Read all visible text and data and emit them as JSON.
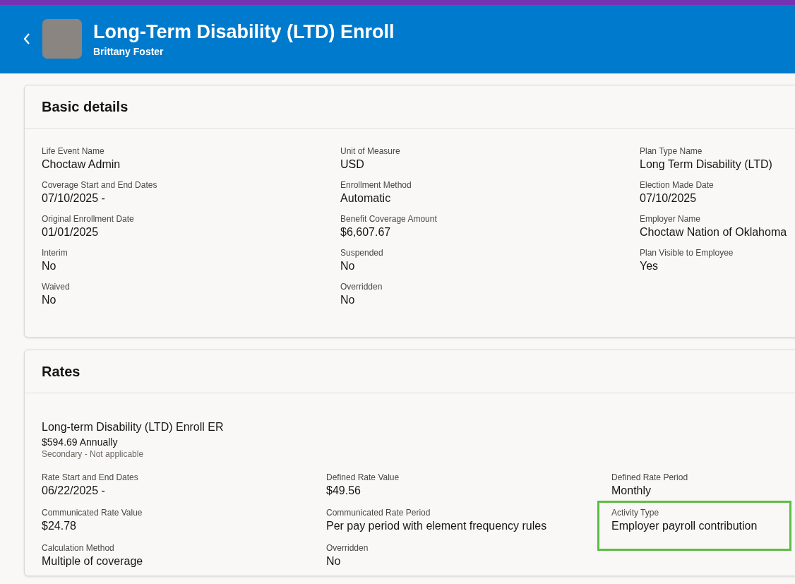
{
  "header": {
    "title": "Long-Term Disability (LTD) Enroll",
    "subtitle": "Brittany Foster"
  },
  "basic_details": {
    "title": "Basic details",
    "fields": [
      {
        "label": "Life Event Name",
        "value": "Choctaw Admin"
      },
      {
        "label": "Unit of Measure",
        "value": "USD"
      },
      {
        "label": "Plan Type Name",
        "value": "Long Term Disability (LTD)"
      },
      {
        "label": "Coverage Start and End Dates",
        "value": "07/10/2025 -"
      },
      {
        "label": "Enrollment Method",
        "value": "Automatic"
      },
      {
        "label": "Election Made Date",
        "value": "07/10/2025"
      },
      {
        "label": "Original Enrollment Date",
        "value": "01/01/2025"
      },
      {
        "label": "Benefit Coverage Amount",
        "value": "$6,607.67"
      },
      {
        "label": "Employer Name",
        "value": "Choctaw Nation of Oklahoma"
      },
      {
        "label": "Interim",
        "value": "No"
      },
      {
        "label": "Suspended",
        "value": "No"
      },
      {
        "label": "Plan Visible to Employee",
        "value": "Yes"
      },
      {
        "label": "Waived",
        "value": "No"
      },
      {
        "label": "Overridden",
        "value": "No"
      }
    ]
  },
  "rates": {
    "title": "Rates",
    "plan_name": "Long-term Disability (LTD) Enroll ER",
    "amount": "$594.69 Annually",
    "note": "Secondary - Not applicable",
    "fields": [
      {
        "label": "Rate Start and End Dates",
        "value": "06/22/2025 -",
        "highlighted": false
      },
      {
        "label": "Defined Rate Value",
        "value": "$49.56",
        "highlighted": false
      },
      {
        "label": "Defined Rate Period",
        "value": "Monthly",
        "highlighted": false
      },
      {
        "label": "Communicated Rate Value",
        "value": "$24.78",
        "highlighted": false
      },
      {
        "label": "Communicated Rate Period",
        "value": "Per pay period with element frequency rules",
        "highlighted": false
      },
      {
        "label": "Activity Type",
        "value": "Employer payroll contribution",
        "highlighted": true
      },
      {
        "label": "Calculation Method",
        "value": "Multiple of coverage",
        "highlighted": false
      },
      {
        "label": "Overridden",
        "value": "No",
        "highlighted": false
      }
    ]
  }
}
